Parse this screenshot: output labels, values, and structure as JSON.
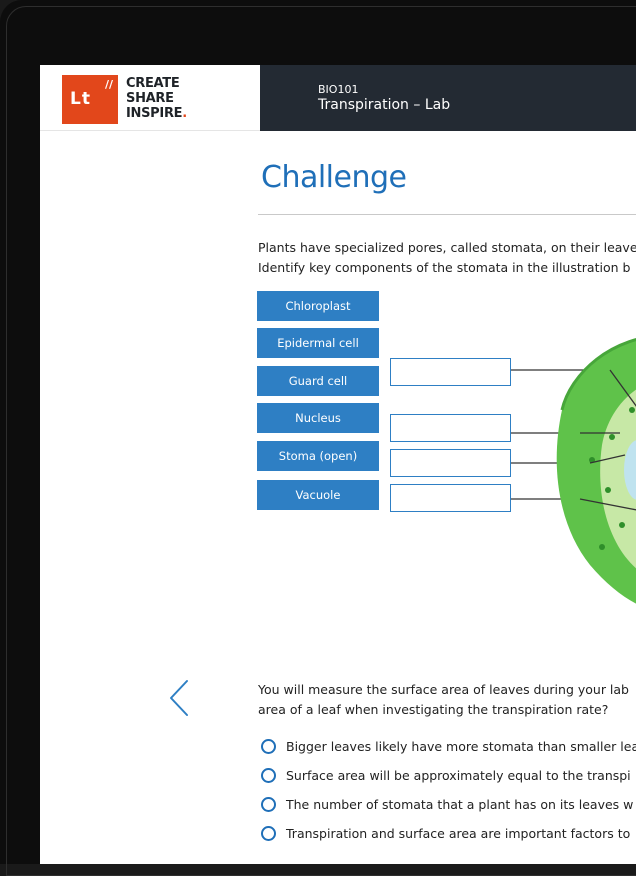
{
  "brand": {
    "mark": "Lt",
    "line1": "CREATE",
    "line2": "SHARE",
    "line3": "INSPIRE",
    "line3_dot": "."
  },
  "header": {
    "course_code": "BIO101",
    "course_title": "Transpiration – Lab"
  },
  "main": {
    "title": "Challenge",
    "intro_line1": "Plants have specialized pores, called stomata, on their leave",
    "intro_line2": "Identify key components of the stomata in the illustration b",
    "labels": [
      "Chloroplast",
      "Epidermal cell",
      "Guard cell",
      "Nucleus",
      "Stoma (open)",
      "Vacuole"
    ],
    "question_line1": "You will measure the surface area of leaves during your lab",
    "question_line2": "area of a leaf when investigating the transpiration rate?",
    "options": [
      "Bigger leaves likely have more stomata than smaller lea",
      "Surface area will be approximately equal to the transpi",
      "The number of stomata that a plant has on its leaves w",
      "Transpiration and surface area are important factors to"
    ]
  },
  "colors": {
    "accent": "#2e7fc4",
    "title_blue": "#1f6fb8",
    "brand_orange": "#e2471b",
    "header_dark": "#232a33",
    "cell_green": "#5fc24a",
    "cell_light": "#c7e8a6"
  },
  "icons": {
    "back": "chevron-left-icon"
  }
}
